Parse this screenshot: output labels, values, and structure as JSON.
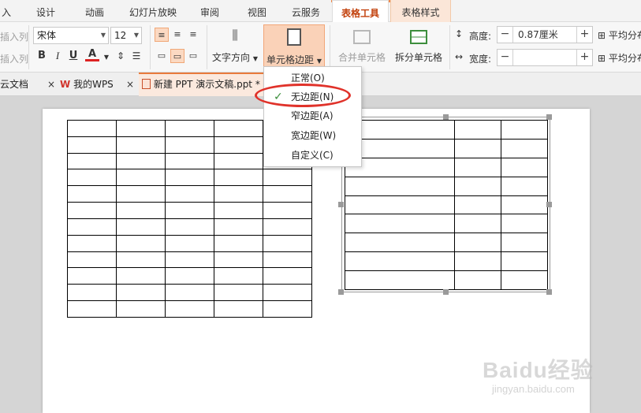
{
  "ribbon_tabs": [
    {
      "label": "入",
      "active": false
    },
    {
      "label": "设计",
      "active": false
    },
    {
      "label": "动画",
      "active": false
    },
    {
      "label": "幻灯片放映",
      "active": false
    },
    {
      "label": "审阅",
      "active": false
    },
    {
      "label": "视图",
      "active": false
    },
    {
      "label": "云服务",
      "active": false
    },
    {
      "label": "表格工具",
      "active": true
    },
    {
      "label": "表格样式",
      "active": false
    }
  ],
  "ribbon": {
    "insert_col_1": "插入列",
    "insert_col_2": "插入列",
    "font_name": "宋体",
    "font_size": "12",
    "bold": "B",
    "italic": "I",
    "underline": "U",
    "font_color": "A",
    "text_direction": "文字方向",
    "cell_margin": "单元格边距",
    "merge_cells": "合并单元格",
    "split_cells": "拆分单元格",
    "height_label": "高度:",
    "height_value": "0.87厘米",
    "width_label": "宽度:",
    "width_value": "",
    "avg_row": "平均分布各行",
    "avg_col": "平均分布各列"
  },
  "doc_tabs": [
    {
      "label": "云文档",
      "close": "×"
    },
    {
      "label": "我的WPS",
      "close": "×"
    },
    {
      "label": "新建 PPT 演示文稿.ppt *",
      "close": ""
    }
  ],
  "cell_margin_menu": {
    "items": [
      {
        "label": "正常(O)",
        "checked": false
      },
      {
        "label": "无边距(N)",
        "checked": true
      },
      {
        "label": "窄边距(A)",
        "checked": false
      },
      {
        "label": "宽边距(W)",
        "checked": false
      },
      {
        "label": "自定义(C)",
        "checked": false
      }
    ],
    "check_glyph": "✓"
  },
  "slide": {
    "left_table": {
      "rows": 12,
      "cols": 5
    },
    "right_table": {
      "rows": 9,
      "cols": 3
    }
  },
  "watermark": {
    "line1": "Baidu经验",
    "line2": "jingyan.baidu.com"
  },
  "colors": {
    "accent": "#e87a3b",
    "circle": "#e0322a",
    "check": "#3a8e3a"
  }
}
